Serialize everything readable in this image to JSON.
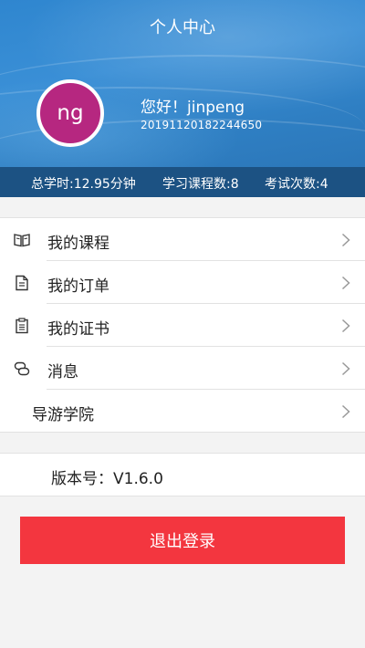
{
  "header": {
    "title": "个人中心",
    "avatar_text": "ng",
    "greeting": "您好！jinpeng",
    "user_id": "20191120182244650",
    "colors": {
      "banner": "#2f86cf",
      "stats_bar": "#1c5283",
      "avatar": "#b62780"
    }
  },
  "stats": {
    "study_time": "总学时:12.95分钟",
    "courses": "学习课程数:8",
    "exams": "考试次数:4"
  },
  "menu": {
    "items": [
      {
        "label": "我的课程",
        "icon": "book-icon"
      },
      {
        "label": "我的订单",
        "icon": "document-icon"
      },
      {
        "label": "我的证书",
        "icon": "certificate-icon"
      },
      {
        "label": "消息",
        "icon": "message-icon"
      },
      {
        "label": "导游学院",
        "icon": ""
      }
    ]
  },
  "version": {
    "label": "版本号：V1.6.0"
  },
  "logout": {
    "label": "退出登录",
    "color": "#f3363f"
  }
}
